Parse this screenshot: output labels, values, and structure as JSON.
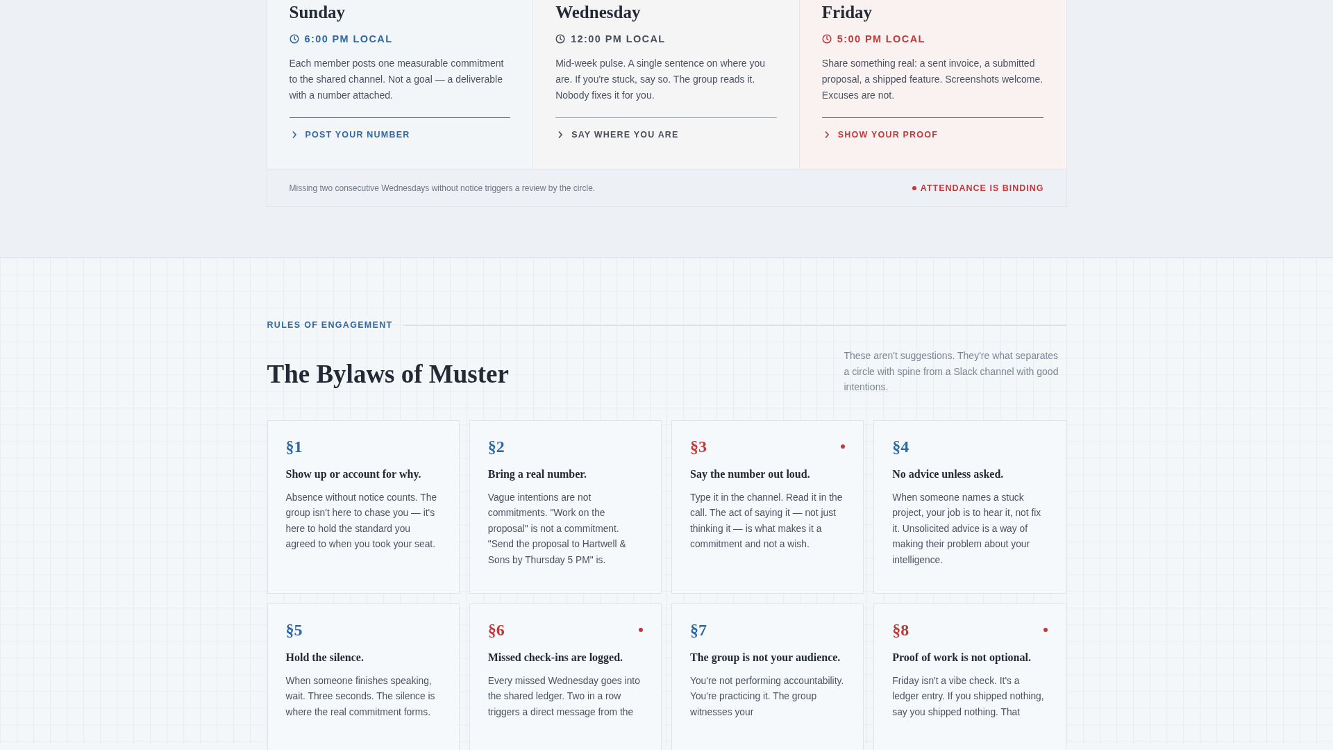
{
  "schedule": {
    "days": [
      {
        "kind": "primary",
        "day": "Sunday",
        "time": "6:00 PM LOCAL",
        "description": "Each member posts one measurable commitment to the shared channel. Not a goal — a deliverable with a number attached.",
        "action": "POST YOUR NUMBER"
      },
      {
        "kind": "neutral",
        "day": "Wednesday",
        "time": "12:00 PM LOCAL",
        "description": "Mid-week pulse. A single sentence on where you are. If you're stuck, say so. The group reads it. Nobody fixes it for you.",
        "action": "SAY WHERE YOU ARE"
      },
      {
        "kind": "alert",
        "day": "Friday",
        "time": "5:00 PM LOCAL",
        "description": "Share something real: a sent invoice, a submitted proposal, a shipped feature. Screenshots welcome. Excuses are not.",
        "action": "SHOW YOUR PROOF"
      }
    ],
    "footnote": "Missing two consecutive Wednesdays without notice triggers a review by the circle.",
    "badge": "ATTENDANCE IS BINDING"
  },
  "bylaws": {
    "eyebrow": "RULES OF ENGAGEMENT",
    "title": "The Bylaws of Muster",
    "intro": "These aren't suggestions. They're what separates a circle with spine from a Slack channel with good intentions.",
    "rules": [
      {
        "number": "§1",
        "flagged": false,
        "title": "Show up or account for why.",
        "body": "Absence without notice counts. The group isn't here to chase you — it's here to hold the standard you agreed to when you took your seat."
      },
      {
        "number": "§2",
        "flagged": false,
        "title": "Bring a real number.",
        "body": "Vague intentions are not commitments. \"Work on the proposal\" is not a commitment. \"Send the proposal to Hartwell & Sons by Thursday 5 PM\" is."
      },
      {
        "number": "§3",
        "flagged": true,
        "title": "Say the number out loud.",
        "body": "Type it in the channel. Read it in the call. The act of saying it — not just thinking it — is what makes it a commitment and not a wish."
      },
      {
        "number": "§4",
        "flagged": false,
        "title": "No advice unless asked.",
        "body": "When someone names a stuck project, your job is to hear it, not fix it. Unsolicited advice is a way of making their problem about your intelligence."
      },
      {
        "number": "§5",
        "flagged": false,
        "title": "Hold the silence.",
        "body": "When someone finishes speaking, wait. Three seconds. The silence is where the real commitment forms."
      },
      {
        "number": "§6",
        "flagged": true,
        "title": "Missed check-ins are logged.",
        "body": "Every missed Wednesday goes into the shared ledger. Two in a row triggers a direct message from the"
      },
      {
        "number": "§7",
        "flagged": false,
        "title": "The group is not your audience.",
        "body": "You're not performing accountability. You're practicing it. The group witnesses your"
      },
      {
        "number": "§8",
        "flagged": true,
        "title": "Proof of work is not optional.",
        "body": "Friday isn't a vibe check. It's a ledger entry. If you shipped nothing, say you shipped nothing. That"
      }
    ]
  }
}
